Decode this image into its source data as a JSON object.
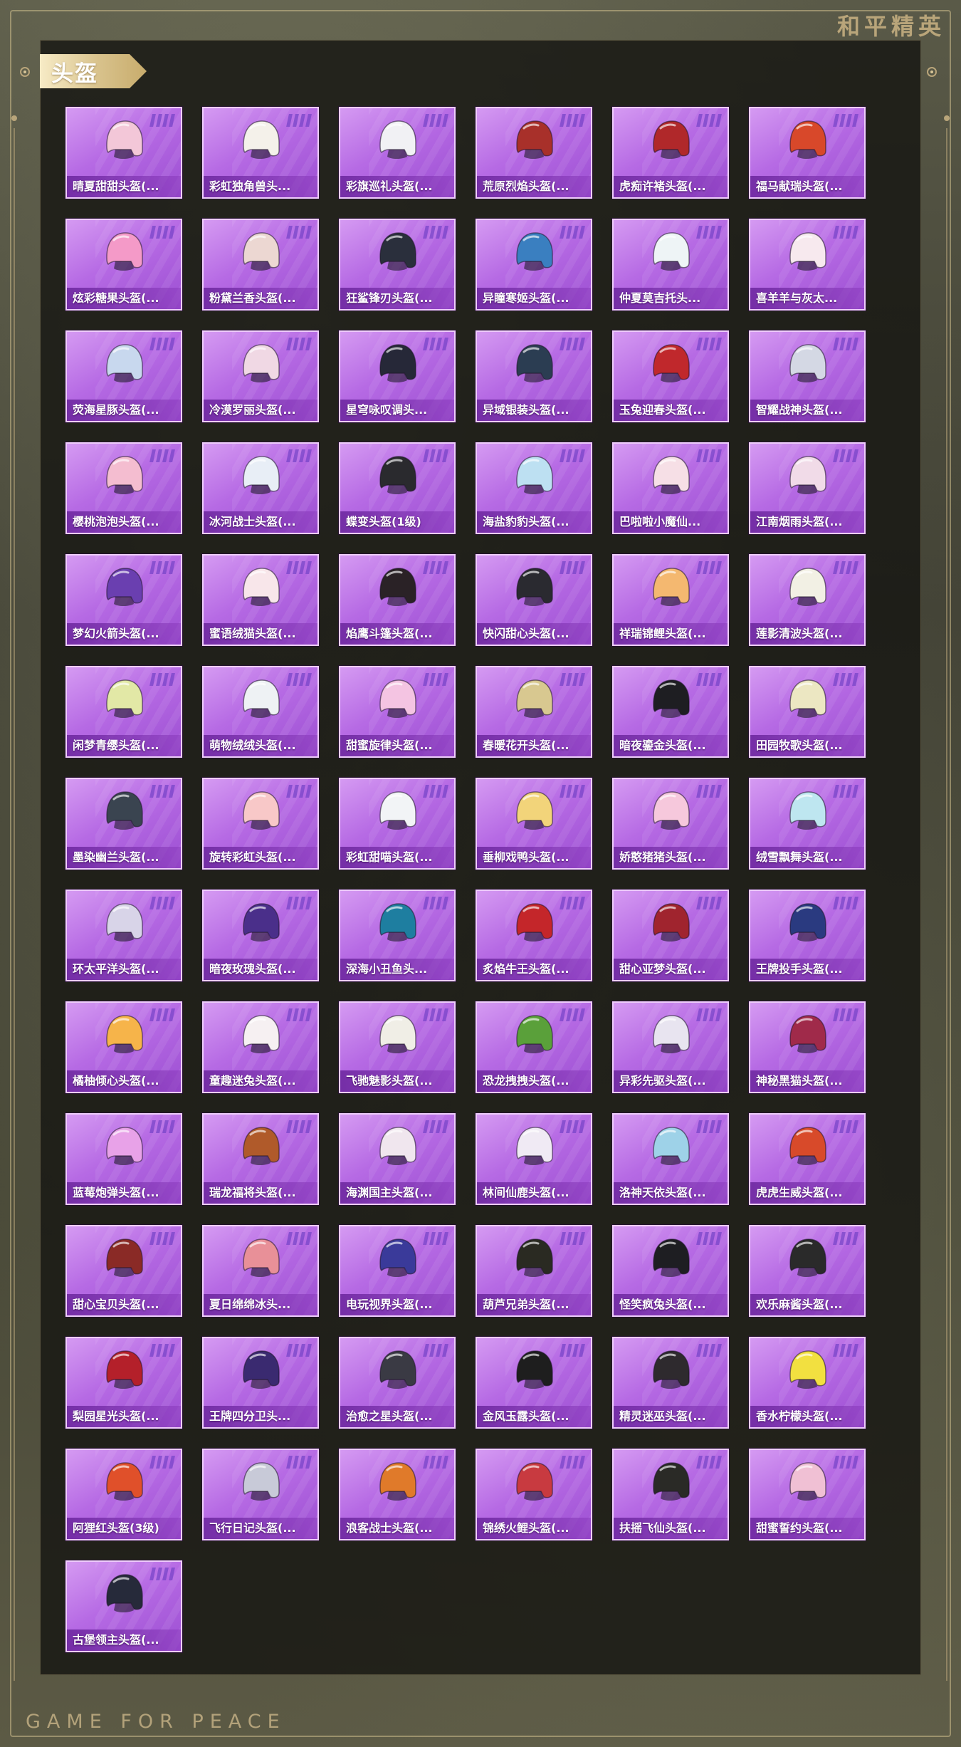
{
  "brand": "和平精英",
  "footer": "GAME FOR PEACE",
  "section_title": "头盔",
  "items": [
    {
      "label": "晴夏甜甜头盔(...",
      "color": "#f3c7d8",
      "icon": "helmet-icon"
    },
    {
      "label": "彩虹独角兽头...",
      "color": "#f4f1ea",
      "icon": "helmet-icon"
    },
    {
      "label": "彩旗巡礼头盔(...",
      "color": "#f1f1f4",
      "icon": "helmet-icon"
    },
    {
      "label": "荒原烈焰头盔(...",
      "color": "#a8302a",
      "icon": "helmet-icon"
    },
    {
      "label": "虎痴许褚头盔(...",
      "color": "#b0282a",
      "icon": "helmet-icon"
    },
    {
      "label": "福马献瑞头盔(...",
      "color": "#d8482a",
      "icon": "helmet-icon"
    },
    {
      "label": "炫彩糖果头盔(...",
      "color": "#f49ac8",
      "icon": "helmet-icon"
    },
    {
      "label": "粉黛兰香头盔(...",
      "color": "#ecd7d2",
      "icon": "helmet-icon"
    },
    {
      "label": "狂鲨锋刃头盔(...",
      "color": "#2a2f3c",
      "icon": "helmet-icon"
    },
    {
      "label": "异瞳寒姬头盔(...",
      "color": "#3a7fc0",
      "icon": "helmet-icon"
    },
    {
      "label": "仲夏莫吉托头...",
      "color": "#eef4f6",
      "icon": "helmet-icon"
    },
    {
      "label": "喜羊羊与灰太...",
      "color": "#f7e9ee",
      "icon": "helmet-icon"
    },
    {
      "label": "荧海星豚头盔(...",
      "color": "#c8d8ee",
      "icon": "helmet-icon"
    },
    {
      "label": "冷漠罗丽头盔(...",
      "color": "#f0d8e4",
      "icon": "helmet-icon"
    },
    {
      "label": "星穹咏叹调头...",
      "color": "#262838",
      "icon": "helmet-icon"
    },
    {
      "label": "异域银装头盔(...",
      "color": "#2b3d52",
      "icon": "helmet-icon"
    },
    {
      "label": "玉兔迎春头盔(...",
      "color": "#c0282c",
      "icon": "helmet-icon"
    },
    {
      "label": "智耀战神头盔(...",
      "color": "#d4d8e4",
      "icon": "helmet-icon"
    },
    {
      "label": "樱桃泡泡头盔(...",
      "color": "#f4bdd0",
      "icon": "helmet-icon"
    },
    {
      "label": "冰河战士头盔(...",
      "color": "#e8eef6",
      "icon": "helmet-icon"
    },
    {
      "label": "蝶变头盔(1级)",
      "color": "#2a2a2e",
      "icon": "helmet-icon"
    },
    {
      "label": "海盐豹豹头盔(...",
      "color": "#bde0f2",
      "icon": "helmet-icon"
    },
    {
      "label": "巴啦啦小魔仙...",
      "color": "#f6dfe6",
      "icon": "helmet-icon"
    },
    {
      "label": "江南烟雨头盔(...",
      "color": "#f1dbe8",
      "icon": "helmet-icon"
    },
    {
      "label": "梦幻火箭头盔(...",
      "color": "#6a3fb0",
      "icon": "helmet-icon"
    },
    {
      "label": "蜜语绒猫头盔(...",
      "color": "#f8e6ea",
      "icon": "helmet-icon"
    },
    {
      "label": "焰鹰斗篷头盔(...",
      "color": "#2a2226",
      "icon": "helmet-icon"
    },
    {
      "label": "快闪甜心头盔(...",
      "color": "#2a2a30",
      "icon": "helmet-icon"
    },
    {
      "label": "祥瑞锦鲤头盔(...",
      "color": "#f4b870",
      "icon": "helmet-icon"
    },
    {
      "label": "莲影清波头盔(...",
      "color": "#f2f0e4",
      "icon": "helmet-icon"
    },
    {
      "label": "闲梦青缨头盔(...",
      "color": "#e2e8a6",
      "icon": "helmet-icon"
    },
    {
      "label": "萌物绒绒头盔(...",
      "color": "#eef2f4",
      "icon": "helmet-icon"
    },
    {
      "label": "甜蜜旋律头盔(...",
      "color": "#f4c4e2",
      "icon": "helmet-icon"
    },
    {
      "label": "春暖花开头盔(...",
      "color": "#d8c890",
      "icon": "helmet-icon"
    },
    {
      "label": "暗夜鎏金头盔(...",
      "color": "#1e1e22",
      "icon": "helmet-icon"
    },
    {
      "label": "田园牧歌头盔(...",
      "color": "#ece7c2",
      "icon": "helmet-icon"
    },
    {
      "label": "墨染幽兰头盔(...",
      "color": "#3a4450",
      "icon": "helmet-icon"
    },
    {
      "label": "旋转彩虹头盔(...",
      "color": "#f8c8c8",
      "icon": "helmet-icon"
    },
    {
      "label": "彩虹甜喵头盔(...",
      "color": "#f2f4f6",
      "icon": "helmet-icon"
    },
    {
      "label": "垂柳戏鸭头盔(...",
      "color": "#f2d47a",
      "icon": "helmet-icon"
    },
    {
      "label": "娇憨猪猪头盔(...",
      "color": "#f6c8dc",
      "icon": "helmet-icon"
    },
    {
      "label": "绒雪飘舞头盔(...",
      "color": "#bee6f0",
      "icon": "helmet-icon"
    },
    {
      "label": "环太平洋头盔(...",
      "color": "#d8d4e8",
      "icon": "helmet-icon"
    },
    {
      "label": "暗夜玫瑰头盔(...",
      "color": "#4a2f8a",
      "icon": "helmet-icon"
    },
    {
      "label": "深海小丑鱼头...",
      "color": "#1e7ea0",
      "icon": "helmet-icon"
    },
    {
      "label": "炙焰牛王头盔(...",
      "color": "#c4262a",
      "icon": "helmet-icon"
    },
    {
      "label": "甜心亚梦头盔(...",
      "color": "#a0242e",
      "icon": "helmet-icon"
    },
    {
      "label": "王牌投手头盔(...",
      "color": "#2a3a80",
      "icon": "helmet-icon"
    },
    {
      "label": "橘柚倾心头盔(...",
      "color": "#f6b44a",
      "icon": "helmet-icon"
    },
    {
      "label": "童趣迷兔头盔(...",
      "color": "#f6f0f2",
      "icon": "helmet-icon"
    },
    {
      "label": "飞驰魅影头盔(...",
      "color": "#f0eee6",
      "icon": "helmet-icon"
    },
    {
      "label": "恐龙拽拽头盔(...",
      "color": "#5aa03a",
      "icon": "helmet-icon"
    },
    {
      "label": "异彩先驱头盔(...",
      "color": "#e8e4f0",
      "icon": "helmet-icon"
    },
    {
      "label": "神秘黑猫头盔(...",
      "color": "#a02a4a",
      "icon": "helmet-icon"
    },
    {
      "label": "蓝莓炮弹头盔(...",
      "color": "#e8a2e8",
      "icon": "helmet-icon"
    },
    {
      "label": "瑞龙福将头盔(...",
      "color": "#b05a2a",
      "icon": "helmet-icon"
    },
    {
      "label": "海渊国主头盔(...",
      "color": "#f0e6ee",
      "icon": "helmet-icon"
    },
    {
      "label": "林间仙鹿头盔(...",
      "color": "#f0eaf4",
      "icon": "helmet-icon"
    },
    {
      "label": "洛神天依头盔(...",
      "color": "#9ed2e8",
      "icon": "helmet-icon"
    },
    {
      "label": "虎虎生威头盔(...",
      "color": "#d84a2a",
      "icon": "helmet-icon"
    },
    {
      "label": "甜心宝贝头盔(...",
      "color": "#8a2a26",
      "icon": "helmet-icon"
    },
    {
      "label": "夏日绵绵冰头...",
      "color": "#e89098",
      "icon": "helmet-icon"
    },
    {
      "label": "电玩视界头盔(...",
      "color": "#3a3a9a",
      "icon": "helmet-icon"
    },
    {
      "label": "葫芦兄弟头盔(...",
      "color": "#2a2a22",
      "icon": "helmet-icon"
    },
    {
      "label": "怪笑疯兔头盔(...",
      "color": "#1e1e22",
      "icon": "helmet-icon"
    },
    {
      "label": "欢乐麻酱头盔(...",
      "color": "#2a2a2a",
      "icon": "helmet-icon"
    },
    {
      "label": "梨园星光头盔(...",
      "color": "#b4202a",
      "icon": "helmet-icon"
    },
    {
      "label": "王牌四分卫头...",
      "color": "#3a2a70",
      "icon": "helmet-icon"
    },
    {
      "label": "治愈之星头盔(...",
      "color": "#3a3a44",
      "icon": "helmet-icon"
    },
    {
      "label": "金风玉露头盔(...",
      "color": "#1e1e1e",
      "icon": "helmet-icon"
    },
    {
      "label": "精灵迷巫头盔(...",
      "color": "#2e2a2e",
      "icon": "helmet-icon"
    },
    {
      "label": "香水柠檬头盔(...",
      "color": "#f2e040",
      "icon": "helmet-icon"
    },
    {
      "label": "阿狸红头盔(3级)",
      "color": "#e0502a",
      "icon": "helmet-icon"
    },
    {
      "label": "飞行日记头盔(...",
      "color": "#c8cad8",
      "icon": "helmet-icon"
    },
    {
      "label": "浪客战士头盔(...",
      "color": "#e07a2a",
      "icon": "helmet-icon"
    },
    {
      "label": "锦绣火鲤头盔(...",
      "color": "#c83a40",
      "icon": "helmet-icon"
    },
    {
      "label": "扶摇飞仙头盔(...",
      "color": "#2a2a26",
      "icon": "helmet-icon"
    },
    {
      "label": "甜蜜誓约头盔(...",
      "color": "#f0c0d4",
      "icon": "helmet-icon"
    },
    {
      "label": "古堡领主头盔(...",
      "color": "#262a3a",
      "icon": "helmet-icon"
    }
  ]
}
